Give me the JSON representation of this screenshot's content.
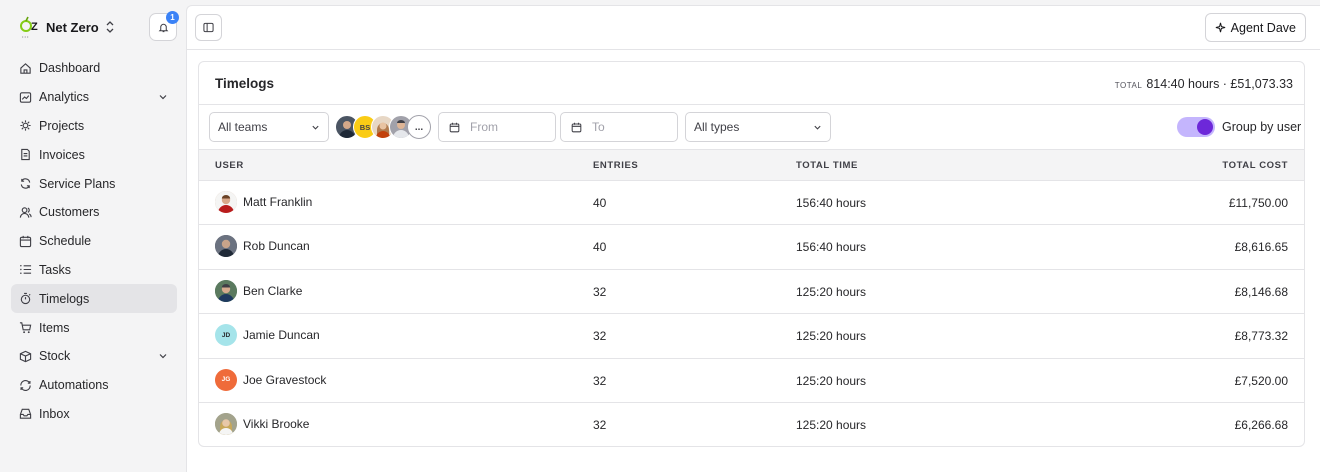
{
  "brand": {
    "name": "Net Zero",
    "notifications": "1"
  },
  "nav": [
    {
      "label": "Dashboard",
      "icon": "home-icon"
    },
    {
      "label": "Analytics",
      "icon": "chart-icon",
      "expandable": true
    },
    {
      "label": "Projects",
      "icon": "projects-icon"
    },
    {
      "label": "Invoices",
      "icon": "invoice-icon"
    },
    {
      "label": "Service Plans",
      "icon": "refresh-icon"
    },
    {
      "label": "Customers",
      "icon": "users-icon"
    },
    {
      "label": "Schedule",
      "icon": "calendar-icon"
    },
    {
      "label": "Tasks",
      "icon": "list-icon"
    },
    {
      "label": "Timelogs",
      "icon": "timer-icon",
      "active": true
    },
    {
      "label": "Items",
      "icon": "cart-icon"
    },
    {
      "label": "Stock",
      "icon": "box-icon",
      "expandable": true
    },
    {
      "label": "Automations",
      "icon": "automation-icon"
    },
    {
      "label": "Inbox",
      "icon": "inbox-icon"
    }
  ],
  "topbar": {
    "agent_label": "Agent Dave"
  },
  "card": {
    "title": "Timelogs",
    "total_label": "TOTAL",
    "total_value": "814:40 hours · £51,073.33"
  },
  "filters": {
    "teams": "All teams",
    "from_placeholder": "From",
    "to_placeholder": "To",
    "types": "All types",
    "group_by_label": "Group by user",
    "group_by_enabled": true,
    "avatars": [
      {
        "initials": "",
        "color": "#4b5563"
      },
      {
        "initials": "BS",
        "color": "#facc15"
      },
      {
        "initials": "",
        "color": "#d6b89a"
      },
      {
        "initials": "",
        "color": "#71717a"
      },
      {
        "initials": "...",
        "color": "#ffffff"
      }
    ]
  },
  "table": {
    "columns": [
      "USER",
      "ENTRIES",
      "TOTAL TIME",
      "TOTAL COST"
    ],
    "rows": [
      {
        "user": "Matt Franklin",
        "initials": "",
        "avatar_color": "#c8a48a",
        "entries": "40",
        "time": "156:40 hours",
        "cost": "£11,750.00"
      },
      {
        "user": "Rob Duncan",
        "initials": "",
        "avatar_color": "#52525b",
        "entries": "40",
        "time": "156:40 hours",
        "cost": "£8,616.65"
      },
      {
        "user": "Ben Clarke",
        "initials": "",
        "avatar_color": "#4d7c5a",
        "entries": "32",
        "time": "125:20 hours",
        "cost": "£8,146.68"
      },
      {
        "user": "Jamie Duncan",
        "initials": "JD",
        "avatar_color": "#a5e4ea",
        "entries": "32",
        "time": "125:20 hours",
        "cost": "£8,773.32"
      },
      {
        "user": "Joe Gravestock",
        "initials": "JG",
        "avatar_color": "#ef6b3a",
        "entries": "32",
        "time": "125:20 hours",
        "cost": "£7,520.00"
      },
      {
        "user": "Vikki Brooke",
        "initials": "",
        "avatar_color": "#a3a38c",
        "entries": "32",
        "time": "125:20 hours",
        "cost": "£6,266.68"
      }
    ]
  }
}
